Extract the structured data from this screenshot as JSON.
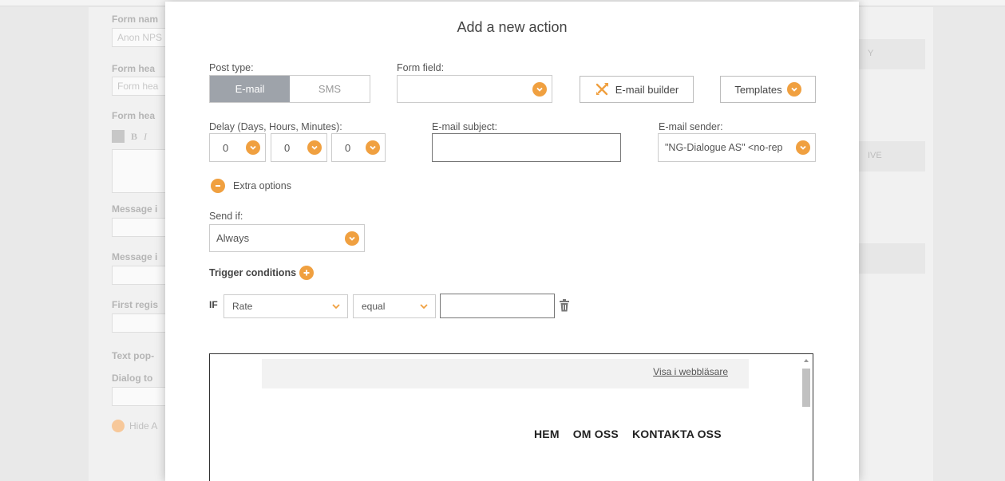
{
  "background": {
    "form_name_label": "Form nam",
    "form_name_value": "Anon NPS",
    "form_header_label": "Form hea",
    "form_header_placeholder": "Form hea",
    "form_header2_label": "Form hea",
    "toolbar_bold": "B",
    "toolbar_italic": "I",
    "message1_label": "Message i",
    "message2_label": "Message i",
    "first_reg_label": "First regis",
    "text_pop_label": "Text pop-",
    "dialog_label": "Dialog to",
    "hide_label": "Hide A",
    "right_bar1": "Y",
    "right_bar2": "IVE"
  },
  "modal": {
    "title": "Add a new action",
    "post_type": {
      "label": "Post type:",
      "options": [
        "E-mail",
        "SMS"
      ],
      "selected": "E-mail"
    },
    "form_field": {
      "label": "Form field:",
      "value": ""
    },
    "email_builder_label": "E-mail builder",
    "templates_label": "Templates",
    "delay": {
      "label": "Delay (Days, Hours, Minutes):",
      "days": "0",
      "hours": "0",
      "minutes": "0"
    },
    "email_subject": {
      "label": "E-mail subject:",
      "value": ""
    },
    "email_sender": {
      "label": "E-mail sender:",
      "value": "\"NG-Dialogue AS\" <no-rep"
    },
    "extra_options_label": "Extra options",
    "send_if": {
      "label": "Send if:",
      "value": "Always"
    },
    "trigger_conditions_label": "Trigger conditions",
    "condition": {
      "if_label": "IF",
      "field": "Rate",
      "operator": "equal",
      "value": ""
    },
    "preview": {
      "view_in_browser": "Visa i webbläsare",
      "nav": [
        "HEM",
        "OM OSS",
        "KONTAKTA OSS"
      ]
    }
  },
  "colors": {
    "accent": "#f0a040",
    "segment_active": "#9ea3aa"
  }
}
